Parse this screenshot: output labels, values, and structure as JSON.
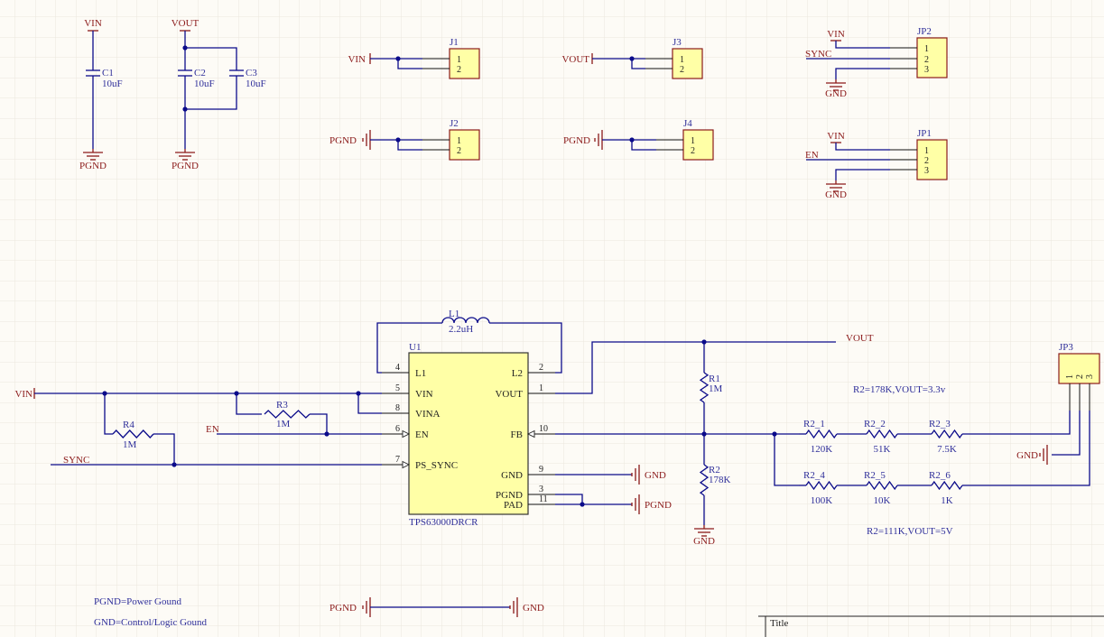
{
  "nets": {
    "vin": "VIN",
    "vout": "VOUT",
    "pgnd": "PGND",
    "gnd": "GND",
    "en": "EN",
    "sync": "SYNC"
  },
  "components": {
    "C1": {
      "ref": "C1",
      "value": "10uF"
    },
    "C2": {
      "ref": "C2",
      "value": "10uF"
    },
    "C3": {
      "ref": "C3",
      "value": "10uF"
    },
    "L1": {
      "ref": "L1",
      "value": "2.2uH"
    },
    "R1": {
      "ref": "R1",
      "value": "1M"
    },
    "R2": {
      "ref": "R2",
      "value": "178K"
    },
    "R3": {
      "ref": "R3",
      "value": "1M"
    },
    "R4": {
      "ref": "R4",
      "value": "1M"
    },
    "R2_1": {
      "ref": "R2_1",
      "value": "120K"
    },
    "R2_2": {
      "ref": "R2_2",
      "value": "51K"
    },
    "R2_3": {
      "ref": "R2_3",
      "value": "7.5K"
    },
    "R2_4": {
      "ref": "R2_4",
      "value": "100K"
    },
    "R2_5": {
      "ref": "R2_5",
      "value": "10K"
    },
    "R2_6": {
      "ref": "R2_6",
      "value": "1K"
    },
    "U1": {
      "ref": "U1",
      "value": "TPS63000DRCR",
      "pins": [
        {
          "num": "4",
          "name": "L1"
        },
        {
          "num": "5",
          "name": "VIN"
        },
        {
          "num": "8",
          "name": "VINA"
        },
        {
          "num": "6",
          "name": "EN"
        },
        {
          "num": "7",
          "name": "PS_SYNC"
        },
        {
          "num": "2",
          "name": "L2"
        },
        {
          "num": "1",
          "name": "VOUT"
        },
        {
          "num": "10",
          "name": "FB"
        },
        {
          "num": "9",
          "name": "GND"
        },
        {
          "num": "3",
          "name": "PGND"
        },
        {
          "num": "11",
          "name": "PAD"
        }
      ]
    },
    "J1": {
      "ref": "J1",
      "pins": [
        "1",
        "2"
      ]
    },
    "J2": {
      "ref": "J2",
      "pins": [
        "1",
        "2"
      ]
    },
    "J3": {
      "ref": "J3",
      "pins": [
        "1",
        "2"
      ]
    },
    "J4": {
      "ref": "J4",
      "pins": [
        "1",
        "2"
      ]
    },
    "JP1": {
      "ref": "JP1",
      "pins": [
        "1",
        "2",
        "3"
      ]
    },
    "JP2": {
      "ref": "JP2",
      "pins": [
        "1",
        "2",
        "3"
      ]
    },
    "JP3": {
      "ref": "JP3",
      "pins": [
        "1",
        "2",
        "3"
      ]
    }
  },
  "notes": {
    "r2_3v3": "R2=178K,VOUT=3.3v",
    "r2_5v": "R2=111K,VOUT=5V",
    "pgnd_def": "PGND=Power Gound",
    "gnd_def": "GND=Control/Logic Gound"
  },
  "title_block": {
    "title_label": "Title"
  },
  "colors": {
    "wire": "#0b0b8a",
    "net_label": "#8b1a1a",
    "designator": "#2f2f9a",
    "component_fill": "#ffffa6",
    "background": "#fdfbf6"
  }
}
